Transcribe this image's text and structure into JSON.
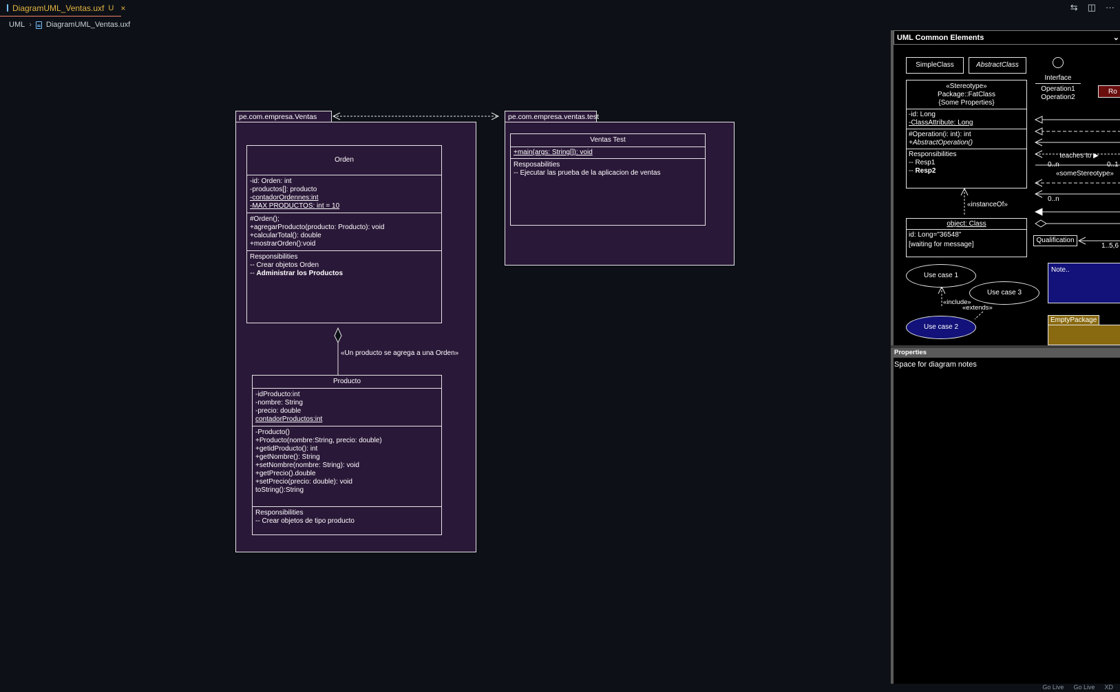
{
  "tab": {
    "filename": "DiagramUML_Ventas.uxf",
    "status": "U",
    "close": "×"
  },
  "tab_actions": {
    "compare": "⇆",
    "split": "◫",
    "more": "···"
  },
  "breadcrumb": {
    "folder": "UML",
    "file": "DiagramUML_Ventas.uxf"
  },
  "diagram": {
    "pkg_ventas": "pe.com.empresa.Ventas",
    "pkg_test": "pe.com.empresa.ventas.test",
    "orden": {
      "name": "Orden",
      "attrs": [
        "-id: Orden: int",
        "-productos[]: producto"
      ],
      "attr_static1": "-contadorOrdennes:int",
      "attr_static2": "-MAX PRODUCTOS: int = 10",
      "methods": [
        "#Orden();",
        "+agregarProducto(producto: Producto): void",
        "+calcularTotal(): double",
        "+mostrarOrden():void"
      ],
      "resp_title": "Responsibilities",
      "resp1": "-- Crear objetos Orden",
      "resp2_prefix": "-- ",
      "resp2_bold": "Administrar los Productos"
    },
    "aggregation_label": "«Un producto se agrega a una Orden»",
    "producto": {
      "name": "Producto",
      "attrs": [
        "-idProducto:int",
        "-nombre: String",
        "-precio: double"
      ],
      "attr_static": "contadorProductos:int",
      "methods": [
        "-Producto()",
        "+Producto(nombre:String, precio: double)",
        "+getidProducto(): int",
        "+getNombre(): String",
        "+setNombre(nombre: String): void",
        "+getPrecio().double",
        "+setPrecio(precio: double): void",
        "toString():String"
      ],
      "resp_title": "Responsibilities",
      "resp1": "-- Crear objetos de tipo producto"
    },
    "ventas_test": {
      "name": "Ventas Test",
      "method": "+main(args: String[]): void",
      "resp_title": "Resposabilities",
      "resp1": "-- Ejecutar las prueba de la aplicacion de ventas"
    }
  },
  "palette": {
    "title": "UML Common Elements",
    "simple_class": "SimpleClass",
    "abstract_class": "AbstractClass",
    "interface": "Interface",
    "op1": "Operation1",
    "op2": "Operation2",
    "ro": "Ro",
    "fat_stereo": "«Stereotype»",
    "fat_pkg": "Package::FatClass",
    "fat_props": "{Some Properties}",
    "fat_attr1": "-id: Long",
    "fat_attr2": "-ClassAttribute: Long",
    "fat_op1": "#Operation(i: int): int",
    "fat_op2": "+AbstractOperation()",
    "fat_resp": "Responsibilities",
    "fat_resp1": "-- Resp1",
    "fat_resp2_prefix": "-- ",
    "fat_resp2": "Resp2",
    "teaches": "teaches to ▶",
    "mult1": "0..n",
    "mult2": "0..1",
    "some_stereo": "«someStereotype»",
    "mult3": "0..n",
    "instance_of": "«instanceOf»",
    "object_class": "object: Class",
    "obj_attr": "id: Long=\"36548\"",
    "obj_state": "[waiting for message]",
    "qualification": "Qualification",
    "qual_mult": "1..5,6",
    "use_case_1": "Use case 1",
    "use_case_2": "Use case 2",
    "use_case_3": "Use case 3",
    "include": "«include»",
    "extends": "«extends»",
    "note": "Note..",
    "empty_package": "EmptyPackage"
  },
  "properties": {
    "title": "Properties",
    "text": "Space for diagram notes"
  },
  "status": {
    "golive1": "Go Live",
    "golive2": "Go Live",
    "xd": "XD"
  }
}
